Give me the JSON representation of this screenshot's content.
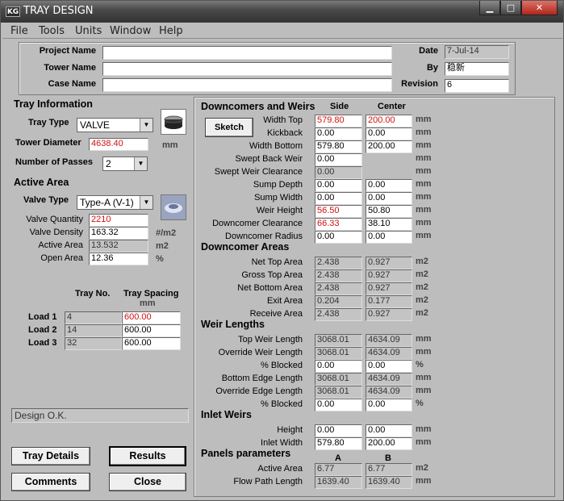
{
  "window": {
    "title": "TRAY DESIGN",
    "app_icon": "KG",
    "min_glyph": "▁",
    "max_glyph": "□",
    "close_glyph": "✕"
  },
  "menu": [
    "File",
    "Tools",
    "Units",
    "Window",
    "Help"
  ],
  "project": {
    "project_name_label": "Project Name",
    "tower_name_label": "Tower Name",
    "case_name_label": "Case Name",
    "project_name": "",
    "tower_name": "",
    "case_name": "",
    "date_label": "Date",
    "date": "7-Jul-14",
    "by_label": "By",
    "by": "稳新",
    "revision_label": "Revision",
    "revision": "6"
  },
  "tray_info": {
    "heading": "Tray Information",
    "tray_type_label": "Tray Type",
    "tray_type": "VALVE",
    "tower_diameter_label": "Tower Diameter",
    "tower_diameter": "4638.40",
    "tower_diameter_unit": "mm",
    "passes_label": "Number of Passes",
    "passes": "2"
  },
  "active_area": {
    "heading": "Active Area",
    "valve_type_label": "Valve Type",
    "valve_type": "Type-A (V-1)",
    "valve_qty_label": "Valve Quantity",
    "valve_qty": "2210",
    "valve_density_label": "Valve Density",
    "valve_density": "163.32",
    "valve_density_unit": "#/m2",
    "active_area_label": "Active Area",
    "active_area": "13.532",
    "active_area_unit": "m2",
    "open_area_label": "Open Area",
    "open_area": "12.36",
    "open_area_unit": "%"
  },
  "loads": {
    "tray_no_header": "Tray No.",
    "spacing_header": "Tray Spacing",
    "spacing_unit": "mm",
    "rows": [
      {
        "label": "Load 1",
        "tray_no": "4",
        "spacing": "600.00"
      },
      {
        "label": "Load 2",
        "tray_no": "14",
        "spacing": "600.00"
      },
      {
        "label": "Load 3",
        "tray_no": "32",
        "spacing": "600.00"
      }
    ]
  },
  "status": "Design O.K.",
  "buttons": {
    "tray_details": "Tray Details",
    "results": "Results",
    "comments": "Comments",
    "close": "Close",
    "sketch": "Sketch"
  },
  "downcomers": {
    "heading": "Downcomers and Weirs",
    "side_header": "Side",
    "center_header": "Center",
    "rows": [
      {
        "label": "Width Top",
        "side": "579.80",
        "center": "200.00",
        "unit": "mm"
      },
      {
        "label": "Kickback",
        "side": "0.00",
        "center": "0.00",
        "unit": "mm"
      },
      {
        "label": "Width Bottom",
        "side": "579.80",
        "center": "200.00",
        "unit": "mm"
      },
      {
        "label": "Swept Back Weir",
        "side": "0.00",
        "center": "",
        "unit": "mm"
      },
      {
        "label": "Swept Weir Clearance",
        "side": "0.00",
        "center": "",
        "unit": "mm"
      },
      {
        "label": "Sump Depth",
        "side": "0.00",
        "center": "0.00",
        "unit": "mm"
      },
      {
        "label": "Sump Width",
        "side": "0.00",
        "center": "0.00",
        "unit": "mm"
      },
      {
        "label": "Weir Height",
        "side": "56.50",
        "center": "50.80",
        "unit": "mm"
      },
      {
        "label": "Downcomer Clearance",
        "side": "66.33",
        "center": "38.10",
        "unit": "mm"
      },
      {
        "label": "Downcomer Radius",
        "side": "0.00",
        "center": "0.00",
        "unit": "mm"
      }
    ]
  },
  "dc_areas": {
    "heading": "Downcomer Areas",
    "rows": [
      {
        "label": "Net Top Area",
        "side": "2.438",
        "center": "0.927",
        "unit": "m2"
      },
      {
        "label": "Gross Top Area",
        "side": "2.438",
        "center": "0.927",
        "unit": "m2"
      },
      {
        "label": "Net Bottom Area",
        "side": "2.438",
        "center": "0.927",
        "unit": "m2"
      },
      {
        "label": "Exit Area",
        "side": "0.204",
        "center": "0.177",
        "unit": "m2"
      },
      {
        "label": "Receive Area",
        "side": "2.438",
        "center": "0.927",
        "unit": "m2"
      }
    ]
  },
  "weir_lengths": {
    "heading": "Weir Lengths",
    "rows": [
      {
        "label": "Top Weir Length",
        "side": "3068.01",
        "center": "4634.09",
        "unit": "mm"
      },
      {
        "label": "Override Weir Length",
        "side": "3068.01",
        "center": "4634.09",
        "unit": "mm"
      },
      {
        "label": "% Blocked",
        "side": "0.00",
        "center": "0.00",
        "unit": "%"
      },
      {
        "label": "Bottom Edge Length",
        "side": "3068.01",
        "center": "4634.09",
        "unit": "mm"
      },
      {
        "label": "Override Edge Length",
        "side": "3068.01",
        "center": "4634.09",
        "unit": "mm"
      },
      {
        "label": "% Blocked",
        "side": "0.00",
        "center": "0.00",
        "unit": "%"
      }
    ]
  },
  "inlet_weirs": {
    "heading": "Inlet Weirs",
    "rows": [
      {
        "label": "Height",
        "side": "0.00",
        "center": "0.00",
        "unit": "mm"
      },
      {
        "label": "Inlet Width",
        "side": "579.80",
        "center": "200.00",
        "unit": "mm"
      }
    ]
  },
  "panels": {
    "heading": "Panels parameters",
    "a_header": "A",
    "b_header": "B",
    "rows": [
      {
        "label": "Active Area",
        "a": "6.77",
        "b": "6.77",
        "unit": "m2"
      },
      {
        "label": "Flow Path Length",
        "a": "1639.40",
        "b": "1639.40",
        "unit": "mm"
      }
    ]
  },
  "icons": {
    "tray_icon": "valve-tray-icon",
    "valve_icon": "valve-icon",
    "dropdown": "chevron-down-icon"
  },
  "colors": {
    "highlight_text": "#d01010",
    "readonly_bg": "#c4c4c4",
    "window_bg": "#bdbdbd"
  }
}
